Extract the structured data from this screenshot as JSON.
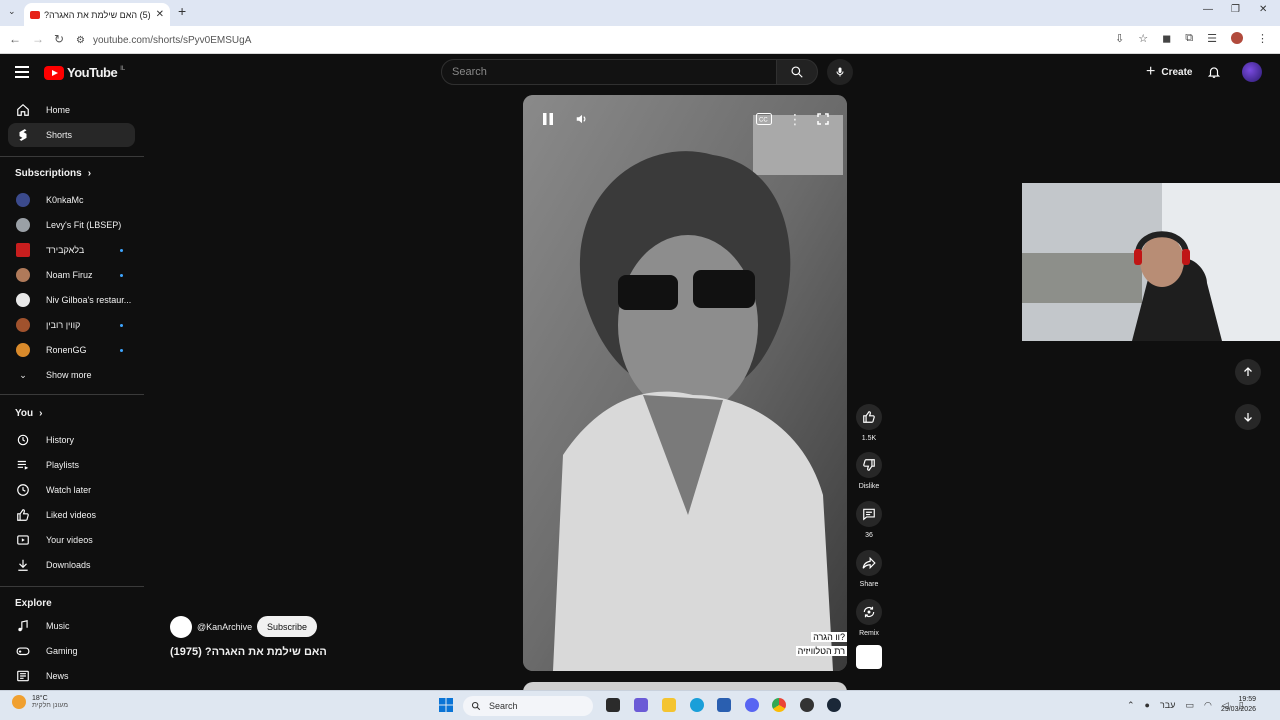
{
  "browser": {
    "tab_title": "(5) האם שילמת את האגרה?",
    "url": "youtube.com/shorts/sPyv0EMSUgA",
    "new_tab": "+",
    "tab_close": "✕"
  },
  "masthead": {
    "logo_text": "YouTube",
    "country_code": "IL",
    "search_placeholder": "Search",
    "create_label": "Create"
  },
  "sidebar": {
    "main": [
      {
        "label": "Home",
        "icon": "home-icon"
      },
      {
        "label": "Shorts",
        "icon": "shorts-icon",
        "active": true
      }
    ],
    "subscriptions_title": "Subscriptions",
    "subscriptions": [
      {
        "label": "K0nkaMc",
        "color": "#3b4a8c",
        "live": false
      },
      {
        "label": "Levy's Fit (LBSEP)",
        "color": "#9aa0a6",
        "live": false
      },
      {
        "label": "בלאקבירד",
        "color": "#c81e1e",
        "live": true
      },
      {
        "label": "Noam Firuz",
        "color": "#b07a5a",
        "live": true
      },
      {
        "label": "Niv Gilboa's restaur...",
        "color": "#e8e8e8",
        "live": true
      },
      {
        "label": "קווין רובין",
        "color": "#a0522d",
        "live": true
      },
      {
        "label": "RonenGG",
        "color": "#d98a2b",
        "live": true
      }
    ],
    "show_more": "Show more",
    "you_title": "You",
    "you_items": [
      {
        "label": "History",
        "icon": "history-icon"
      },
      {
        "label": "Playlists",
        "icon": "playlists-icon"
      },
      {
        "label": "Watch later",
        "icon": "watch-later-icon"
      },
      {
        "label": "Liked videos",
        "icon": "like-icon"
      },
      {
        "label": "Your videos",
        "icon": "your-videos-icon"
      },
      {
        "label": "Downloads",
        "icon": "download-icon"
      }
    ],
    "explore_title": "Explore",
    "explore_items": [
      {
        "label": "Music",
        "icon": "music-icon"
      },
      {
        "label": "Gaming",
        "icon": "gaming-icon"
      },
      {
        "label": "News",
        "icon": "news-icon"
      }
    ]
  },
  "short": {
    "caption_line1": "?וו הגרה",
    "caption_line2": "רת הטלוויזיה",
    "channel": "@KanArchive",
    "subscribe": "Subscribe",
    "title": "האם שילמת את האגרה? (1975)"
  },
  "actions": {
    "likes": "1.5K",
    "dislike": "Dislike",
    "comments": "36",
    "share": "Share",
    "remix": "Remix"
  },
  "taskbar": {
    "search_placeholder": "Search",
    "weather_temp": "18°C",
    "weather_desc": "מעונן חלקית",
    "language": "עבר",
    "time": "19:59",
    "date": "29/03/2026"
  }
}
